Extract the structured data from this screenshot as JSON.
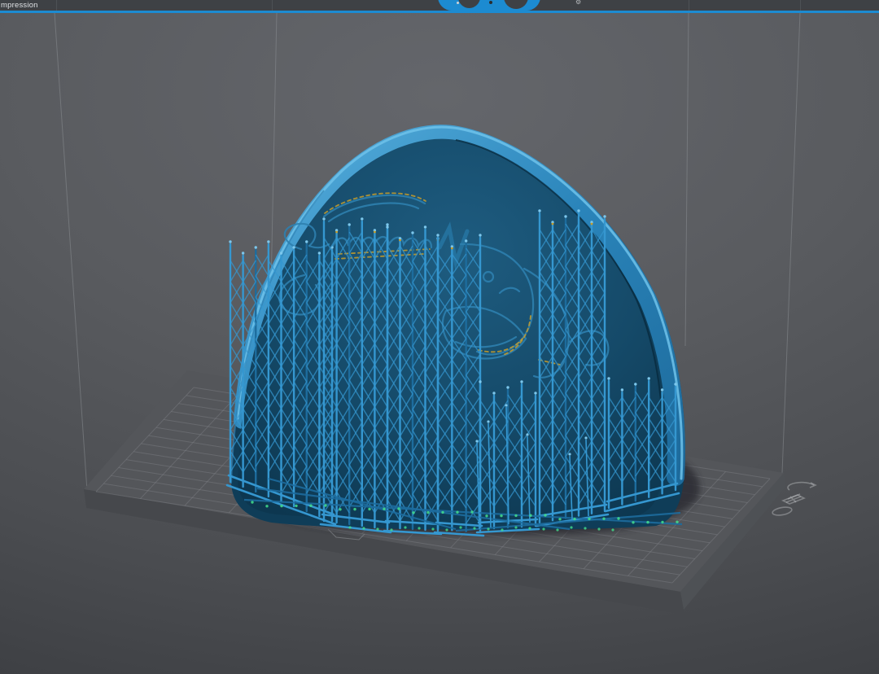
{
  "toolbar": {
    "left_label_partial": "mpression",
    "gear_icon_glyph": "⚙",
    "round_buttons": [
      {
        "name": "round-button-1"
      },
      {
        "name": "round-button-2"
      }
    ]
  },
  "viewport": {
    "content": "3D resin-slicer scene: curved plaque model with lattice support towers standing on a gridded build plate inside a build-volume wireframe",
    "floor_icons": [
      "rotate-icon",
      "grid-icon",
      "ellipse-icon"
    ]
  },
  "scene": {
    "colors": {
      "accent": "#1c8bd1",
      "bar": "#3e4145",
      "bg-center": "#64666b",
      "bg-edge": "#3e4044",
      "bounds": "#8e9296",
      "plate": "#54565a",
      "grid": "#84878b",
      "shadow": "#2a2c30",
      "face-light": "#1e5c80",
      "face-dark": "#0d3750",
      "rim": "#2a84ba",
      "rim-hi": "#6fc2ea",
      "sup": "#3597d0",
      "sup-dk": "#1d6c9d",
      "sup-hi": "#7cc7ec",
      "logo": "#2d7fae",
      "gold": "#c89e2a",
      "green": "#43df8c"
    }
  }
}
